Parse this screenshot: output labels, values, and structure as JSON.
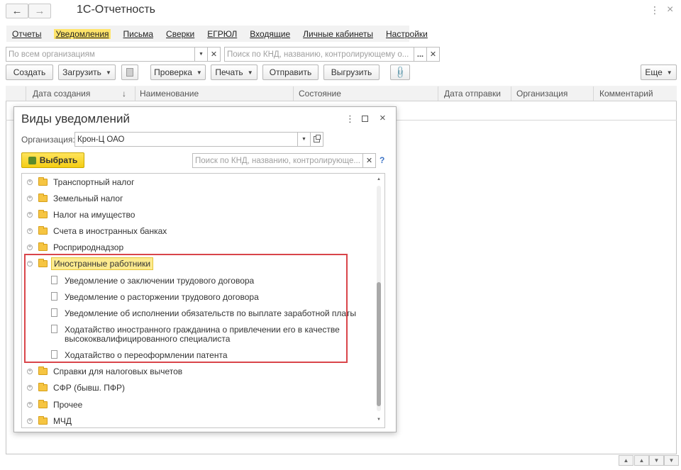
{
  "app": {
    "title": "1С-Отчетность"
  },
  "menu": {
    "items": [
      "Отчеты",
      "Уведомления",
      "Письма",
      "Сверки",
      "ЕГРЮЛ",
      "Входящие",
      "Личные кабинеты",
      "Настройки"
    ],
    "active_index": 1
  },
  "filters": {
    "org_placeholder": "По всем организациям",
    "search_placeholder": "Поиск по КНД, названию, контролирующему о..."
  },
  "toolbar": {
    "create": "Создать",
    "load": "Загрузить",
    "check": "Проверка",
    "print": "Печать",
    "send": "Отправить",
    "upload": "Выгрузить",
    "more": "Еще"
  },
  "table": {
    "columns": [
      "Дата создания",
      "Наименование",
      "Состояние",
      "Дата отправки",
      "Организация",
      "Комментарий"
    ]
  },
  "dialog": {
    "title": "Виды уведомлений",
    "org_label": "Организация:",
    "org_value": "Крон-Ц ОАО",
    "choose_button": "Выбрать",
    "search_placeholder": "Поиск по КНД, названию, контролирующе...",
    "help": "?",
    "tree": [
      {
        "label": "Транспортный налог",
        "type": "folder"
      },
      {
        "label": "Земельный налог",
        "type": "folder"
      },
      {
        "label": "Налог на имущество",
        "type": "folder"
      },
      {
        "label": "Счета в иностранных банках",
        "type": "folder"
      },
      {
        "label": "Росприроднадзор",
        "type": "folder"
      },
      {
        "label": "Иностранные работники",
        "type": "folder",
        "expanded": true,
        "selected": true
      },
      {
        "label": "Уведомление о заключении трудового договора",
        "type": "doc"
      },
      {
        "label": "Уведомление о расторжении трудового договора",
        "type": "doc"
      },
      {
        "label": "Уведомление об исполнении обязательств по выплате заработной платы",
        "type": "doc"
      },
      {
        "label": "Ходатайство иностранного гражданина о привлечении его в качестве",
        "label2": "высококвалифицированного специалиста",
        "type": "doc"
      },
      {
        "label": "Ходатайство о переоформлении патента",
        "type": "doc"
      },
      {
        "label": "Справки для налоговых вычетов",
        "type": "folder"
      },
      {
        "label": "СФР (бывш. ПФР)",
        "type": "folder"
      },
      {
        "label": "Прочее",
        "type": "folder"
      },
      {
        "label": "МЧД",
        "type": "folder"
      }
    ]
  },
  "colors": {
    "accent_yellow": "#f4cd13",
    "highlight_red": "#d9454a",
    "link_blue": "#3c73c6"
  }
}
